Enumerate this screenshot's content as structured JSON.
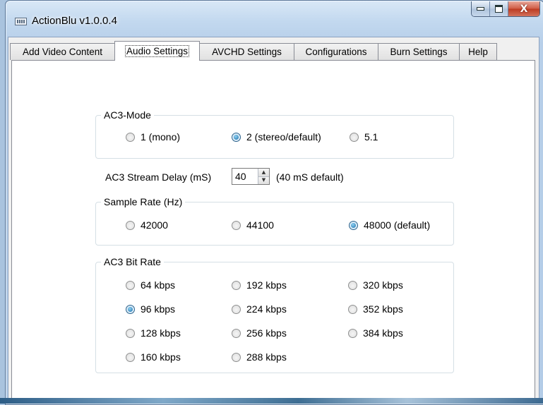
{
  "window": {
    "title": "ActionBlu v1.0.0.4",
    "icon": "app-icon",
    "controls": {
      "minimize": "minimize-icon",
      "maximize": "maximize-icon",
      "close_glyph": "X"
    }
  },
  "tabs": [
    {
      "label": "Add Video Content",
      "active": false
    },
    {
      "label": "Audio Settings",
      "active": true
    },
    {
      "label": "AVCHD Settings",
      "active": false
    },
    {
      "label": "Configurations",
      "active": false
    },
    {
      "label": "Burn Settings",
      "active": false
    },
    {
      "label": "Help",
      "active": false
    }
  ],
  "ac3_mode": {
    "legend": "AC3-Mode",
    "options": [
      {
        "label": "1 (mono)",
        "checked": false
      },
      {
        "label": "2 (stereo/default)",
        "checked": true
      },
      {
        "label": "5.1",
        "checked": false
      }
    ]
  },
  "stream_delay": {
    "label": "AC3 Stream Delay (mS)",
    "value": "40",
    "hint": "(40 mS default)",
    "up_glyph": "▲",
    "down_glyph": "▼"
  },
  "sample_rate": {
    "legend": "Sample Rate (Hz)",
    "options": [
      {
        "label": "42000",
        "checked": false
      },
      {
        "label": "44100",
        "checked": false
      },
      {
        "label": "48000 (default)",
        "checked": true
      }
    ]
  },
  "bit_rate": {
    "legend": "AC3 Bit Rate",
    "options": [
      {
        "label": "64 kbps",
        "checked": false
      },
      {
        "label": "96 kbps",
        "checked": true
      },
      {
        "label": "128 kbps",
        "checked": false
      },
      {
        "label": "160 kbps",
        "checked": false
      },
      {
        "label": "192 kbps",
        "checked": false
      },
      {
        "label": "224 kbps",
        "checked": false
      },
      {
        "label": "256 kbps",
        "checked": false
      },
      {
        "label": "288 kbps",
        "checked": false
      },
      {
        "label": "320 kbps",
        "checked": false
      },
      {
        "label": "352 kbps",
        "checked": false
      },
      {
        "label": "384 kbps",
        "checked": false
      }
    ]
  }
}
